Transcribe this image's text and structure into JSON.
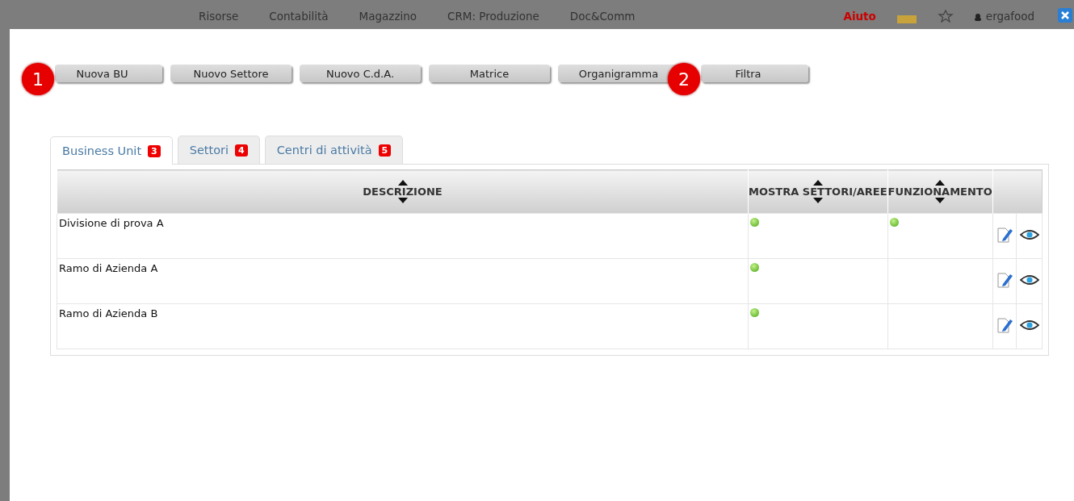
{
  "nav": {
    "items": [
      {
        "label": "Risorse",
        "kind": "menu"
      },
      {
        "label": "Contabilità",
        "kind": "menu"
      },
      {
        "label": "Magazzino",
        "kind": "menu"
      },
      {
        "label": "CRM: Produzione",
        "kind": "menu"
      },
      {
        "label": "Doc&Comm",
        "kind": "menu"
      },
      {
        "label": "Aiuto",
        "kind": "help"
      }
    ],
    "user": "ergafood"
  },
  "toolbar": {
    "buttons": [
      {
        "label": "Nuova BU",
        "callout": "1"
      },
      {
        "label": "Nuovo Settore"
      },
      {
        "label": "Nuovo C.d.A."
      },
      {
        "label": "Matrice"
      },
      {
        "label": "Organigramma"
      },
      {
        "label": "Filtra",
        "callout": "2"
      }
    ]
  },
  "tabs": [
    {
      "label": "Business Unit",
      "badge": "3",
      "selected": true
    },
    {
      "label": "Settori",
      "badge": "4",
      "selected": false
    },
    {
      "label": "Centri di attività",
      "badge": "5",
      "selected": false
    }
  ],
  "table": {
    "columns": [
      "DESCRIZIONE",
      "MOSTRA SETTORI/AREE",
      "FUNZIONAMENTO"
    ],
    "rows": [
      {
        "descrizione": "Divisione di prova A",
        "mostra_settori": true,
        "funzionamento": true
      },
      {
        "descrizione": "Ramo di Azienda A",
        "mostra_settori": true,
        "funzionamento": false
      },
      {
        "descrizione": "Ramo di Azienda B",
        "mostra_settori": true,
        "funzionamento": false
      }
    ]
  }
}
